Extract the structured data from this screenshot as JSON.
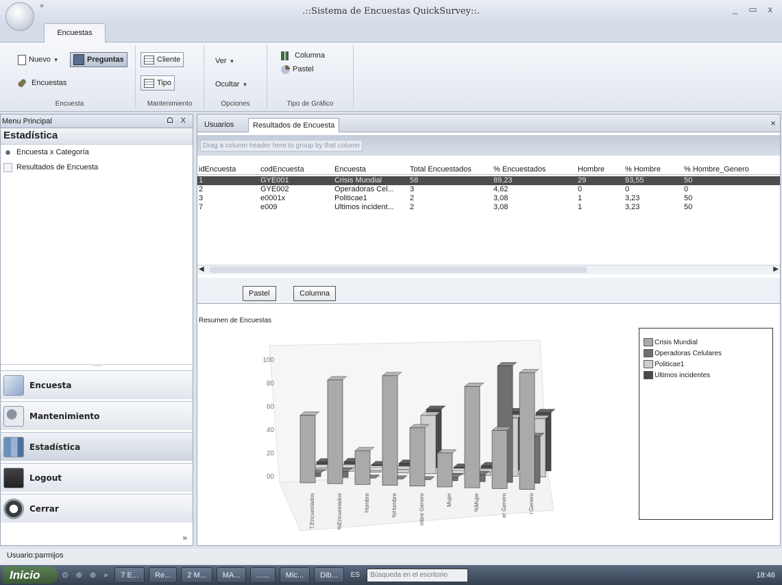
{
  "window": {
    "title": ".::Sistema de Encuestas QuickSurvey::.",
    "quick_access": "=",
    "controls": [
      "_",
      "▭",
      "x"
    ]
  },
  "ribbon": {
    "tab": "Encuestas",
    "groups": {
      "encuesta": {
        "label": "Encuesta",
        "nuevo": "Nuevo",
        "preguntas": "Preguntas",
        "encuestas": "Encuestas"
      },
      "mantenimiento": {
        "label": "Mantenimiento",
        "cliente": "Cliente",
        "tipo": "Tipo"
      },
      "opciones": {
        "label": "Opciones",
        "ver": "Ver",
        "ocultar": "Ocultar"
      },
      "grafico": {
        "label": "Tipo de Gráfico",
        "columna": "Columna",
        "pastel": "Pastel"
      }
    }
  },
  "left_panel": {
    "header": "Menu Principal",
    "header_controls": "ᗝ X",
    "section_title": "Estadística",
    "items": [
      {
        "label": "Encuesta x Categoría"
      },
      {
        "label": "Resultados de Encuesta"
      }
    ],
    "nav": [
      {
        "label": "Encuesta"
      },
      {
        "label": "Mantenimiento"
      },
      {
        "label": "Estadística"
      },
      {
        "label": "Logout"
      },
      {
        "label": "Cerrar"
      }
    ]
  },
  "document": {
    "tabs": [
      "Usuarios",
      "Resultados de Encuesta"
    ],
    "close": "×",
    "group_hint": "Drag a column header here to group by that column",
    "columns": [
      "idEncuesta",
      "codEncuesta",
      "Encuesta",
      "Total Encuestados",
      "% Encuestados",
      "Hombre",
      "% Hombre",
      "% Hombre_Genero"
    ],
    "rows": [
      [
        "1",
        "GYE001",
        "Crisis Mundial",
        "58",
        "89,23",
        "29",
        "93,55",
        "50"
      ],
      [
        "2",
        "GYE002",
        "Operadoras Cel...",
        "3",
        "4,62",
        "0",
        "0",
        "0"
      ],
      [
        "3",
        "e0001x",
        "Politicae1",
        "2",
        "3,08",
        "1",
        "3,23",
        "50"
      ],
      [
        "7",
        "e009",
        "Ultimos incident...",
        "2",
        "3,08",
        "1",
        "3,23",
        "50"
      ]
    ],
    "buttons": {
      "pastel": "Pastel",
      "columna": "Columna"
    }
  },
  "chart_data": {
    "type": "bar",
    "title": "Resumen de Encuestas",
    "categories": [
      "T.Encuestados",
      "%Encuestados",
      "Hombre",
      "%Hombre",
      "%Hombre Genero",
      "Mujer",
      "%Mujer",
      "%Mujer Genero",
      "%Total Genero"
    ],
    "category_labels_visible": [
      "T.Encuestados",
      "%Encuestados",
      "Hombre",
      "%Hombre",
      "mbre Genero",
      "Mujer",
      "%Mujer",
      "er Genero",
      "l Genero"
    ],
    "y_ticks": [
      "00",
      "20",
      "40",
      "60",
      "80",
      "100"
    ],
    "ylim": [
      0,
      100
    ],
    "series": [
      {
        "name": "Crisis Mundial",
        "color": "#a9aba9",
        "values": [
          58,
          89,
          29,
          94,
          50,
          29,
          87,
          50,
          100
        ]
      },
      {
        "name": "Operadoras Celulares",
        "color": "#6f6f6f",
        "values": [
          3,
          5,
          0,
          0,
          0,
          3,
          6,
          100,
          40
        ]
      },
      {
        "name": "Politicae1",
        "color": "#cfcfcf",
        "values": [
          2,
          3,
          1,
          3,
          50,
          1,
          3,
          50,
          50
        ]
      },
      {
        "name": "Ultimos incidentes",
        "color": "#494949",
        "values": [
          2,
          3,
          1,
          3,
          50,
          1,
          3,
          50,
          50
        ]
      }
    ],
    "legend_position": "right"
  },
  "status": {
    "text": "Usuario:parmijos"
  },
  "taskbar": {
    "start": "Inicio",
    "quick_launch": "⊙ ⊚ ⊛ »",
    "buttons": [
      "7 E...",
      "Re...",
      "2 M...",
      "MA...",
      "......",
      "Mic...",
      "Dib..."
    ],
    "lang": "ES",
    "search_placeholder": "Búsqueda en el escritorio",
    "clock": "18:46"
  }
}
